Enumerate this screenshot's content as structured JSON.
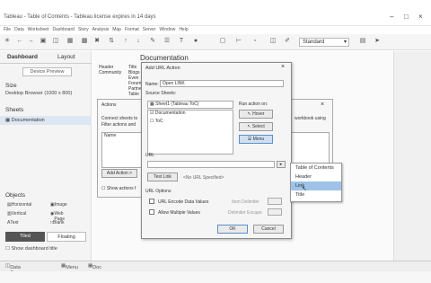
{
  "window": {
    "title": "Tableau - Table of Contents - Tableau license expires in 14 days"
  },
  "menu": [
    "File",
    "Data",
    "Worksheet",
    "Dashboard",
    "Story",
    "Analysis",
    "Map",
    "Format",
    "Server",
    "Window",
    "Help"
  ],
  "toolbar": {
    "view_dropdown": "Standard"
  },
  "left_panel": {
    "tabs": [
      "Dashboard",
      "Layout"
    ],
    "device_preview": "Device Preview",
    "size_heading": "Size",
    "size_value": "Desktop Browser (1000 x 800)",
    "sheets_heading": "Sheets",
    "sheet_item": "Documentation",
    "objects_heading": "Objects",
    "objects": [
      "Horizontal",
      "Image",
      "Vertical",
      "Web Page",
      "Text",
      "Blank"
    ],
    "tiled": "Tiled",
    "floating": "Floating",
    "show_title": "Show dashboard title"
  },
  "canvas": {
    "dashboard_title": "Documentation",
    "header_col1": [
      "Header",
      "Community"
    ],
    "header_col2": [
      "Title",
      "Blogs",
      "Even",
      "Forum",
      "Partne",
      "Table"
    ]
  },
  "actions_dialog": {
    "title": "Actions",
    "text1": "Connect sheets to",
    "text2": "Filter actions and",
    "text_right": "workbook using",
    "col_name": "Name",
    "add_action": "Add Action >",
    "show_actions": "Show actions f"
  },
  "url_dialog": {
    "title": "Add URL Action",
    "name_label": "Name:",
    "name_value": "Open LINK",
    "source_sheets_label": "Source Sheets:",
    "source_select": "Sheet1 (Tableau ToC)",
    "source_items": [
      "Documentation",
      "ToC"
    ],
    "run_action_label": "Run action on:",
    "run_options": [
      "Hover",
      "Select",
      "Menu"
    ],
    "url_label": "URL",
    "test_link": "Test Link",
    "no_url": "<No URL Specified>",
    "url_options_label": "URL Options",
    "encode": "URL Encode Data Values",
    "allow_multiple": "Allow Multiple Values",
    "item_delimiter": "Item Delimiter",
    "delimiter_escape": "Delimiter Escape",
    "ok": "OK",
    "cancel": "Cancel"
  },
  "field_popup": {
    "items": [
      "Table of Contents",
      "Header",
      "Link",
      "Title"
    ],
    "selected": "Link"
  },
  "bottom_tabs": [
    "Data Source",
    "Menu",
    "Doc"
  ]
}
